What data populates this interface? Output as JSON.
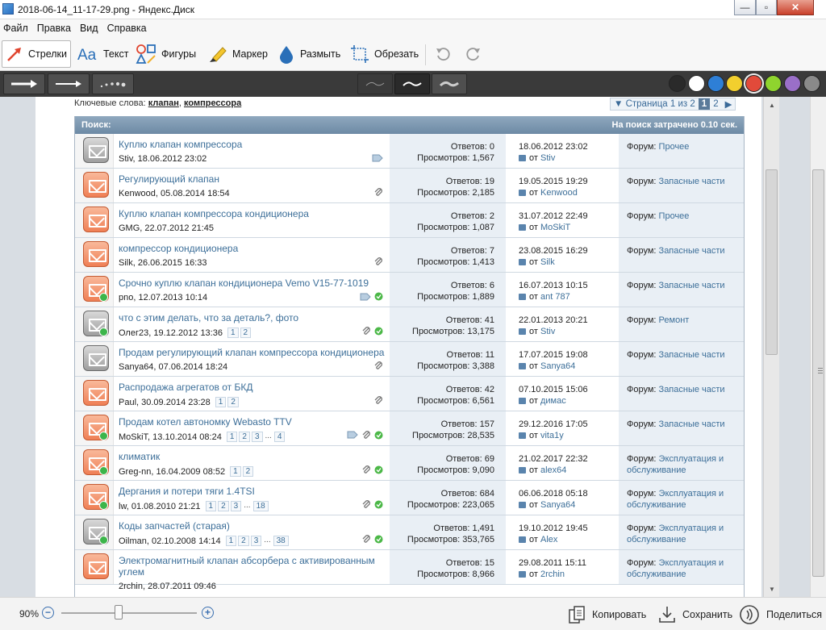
{
  "window": {
    "title": "2018-06-14_11-17-29.png - Яндекс.Диск",
    "minimize": "—",
    "maximize": "▫",
    "close": "✕"
  },
  "menu": [
    "Файл",
    "Правка",
    "Вид",
    "Справка"
  ],
  "toolbar": {
    "tools": [
      {
        "label": "Стрелки",
        "icon": "arrow-icon",
        "active": true
      },
      {
        "label": "Текст",
        "icon": "text-icon"
      },
      {
        "label": "Фигуры",
        "icon": "shapes-icon"
      },
      {
        "label": "Маркер",
        "icon": "marker-icon"
      },
      {
        "label": "Размыть",
        "icon": "blur-drop-icon"
      },
      {
        "label": "Обрезать",
        "icon": "crop-icon"
      }
    ]
  },
  "palette": {
    "colors": [
      "#2a2a2a",
      "#ffffff",
      "#2e7fd6",
      "#f2cf2e",
      "#e24a3a",
      "#8fd42e",
      "#9a6fc8",
      "#8a8a8a"
    ],
    "selected_index": 4
  },
  "content": {
    "keywords_label": "Ключевые слова:",
    "keyword_1": "клапан",
    "keyword_sep": ",",
    "keyword_2": "компрессора",
    "pager": {
      "label": "▼ Страница 1 из 2",
      "current": "1",
      "next_page": "2",
      "next": "▶"
    },
    "header_left": "Поиск:",
    "header_right": "На поиск затрачено 0.10 сек.",
    "rows": [
      {
        "title": "Куплю клапан компрессора",
        "meta": "Stiv, 18.06.2012 23:02",
        "replies": "Ответов: 0",
        "views": "Просмотров: 1,567",
        "last_date": "18.06.2012 23:02",
        "last_from": "от",
        "last_user": "Stiv",
        "forum_label": "Форум:",
        "forum": "Прочее",
        "forum2": "",
        "pages": []
      },
      {
        "title": "Регулирующий клапан",
        "meta": "Kenwood, 05.08.2014 18:54",
        "replies": "Ответов: 19",
        "views": "Просмотров: 2,185",
        "last_date": "19.05.2015 19:29",
        "last_from": "от",
        "last_user": "Kenwood",
        "forum_label": "Форум:",
        "forum": "Запасные части",
        "forum2": "",
        "pages": []
      },
      {
        "title": "Куплю клапан компрессора кондиционера",
        "meta": "GMG, 22.07.2012 21:45",
        "replies": "Ответов: 2",
        "views": "Просмотров: 1,087",
        "last_date": "31.07.2012 22:49",
        "last_from": "от",
        "last_user": "MoSkiT",
        "forum_label": "Форум:",
        "forum": "Прочее",
        "forum2": "",
        "pages": []
      },
      {
        "title": "компрессор кондиционера",
        "meta": "Silk, 26.06.2015 16:33",
        "replies": "Ответов: 7",
        "views": "Просмотров: 1,413",
        "last_date": "23.08.2015 16:29",
        "last_from": "от",
        "last_user": "Silk",
        "forum_label": "Форум:",
        "forum": "Запасные части",
        "forum2": "",
        "pages": []
      },
      {
        "title": "Срочно куплю клапан кондиционера Vemo V15-77-1019",
        "meta": "pno, 12.07.2013 10:14",
        "replies": "Ответов: 6",
        "views": "Просмотров: 1,889",
        "last_date": "16.07.2013 10:15",
        "last_from": "от",
        "last_user": "ant 787",
        "forum_label": "Форум:",
        "forum": "Запасные части",
        "forum2": "",
        "pages": []
      },
      {
        "title": "что с этим делать, что за деталь?, фото",
        "meta": "Олег23, 19.12.2012 13:36",
        "replies": "Ответов: 41",
        "views": "Просмотров: 13,175",
        "last_date": "22.01.2013 20:21",
        "last_from": "от",
        "last_user": "Stiv",
        "forum_label": "Форум:",
        "forum": "Ремонт",
        "forum2": "",
        "pages": [
          "1",
          "2"
        ]
      },
      {
        "title": "Продам регулирующий клапан компрессора кондиционера",
        "meta": "Sanya64, 07.06.2014 18:24",
        "replies": "Ответов: 11",
        "views": "Просмотров: 3,388",
        "last_date": "17.07.2015 19:08",
        "last_from": "от",
        "last_user": "Sanya64",
        "forum_label": "Форум:",
        "forum": "Запасные части",
        "forum2": "",
        "pages": []
      },
      {
        "title": "Распродажа агрегатов от БКД",
        "meta": "Paul, 30.09.2014 23:28",
        "replies": "Ответов: 42",
        "views": "Просмотров: 6,561",
        "last_date": "07.10.2015 15:06",
        "last_from": "от",
        "last_user": "димас",
        "forum_label": "Форум:",
        "forum": "Запасные части",
        "forum2": "",
        "pages": [
          "1",
          "2"
        ]
      },
      {
        "title": "Продам котел автономку Webasto TTV",
        "meta": "MoSkiT, 13.10.2014 08:24",
        "replies": "Ответов: 157",
        "views": "Просмотров: 28,535",
        "last_date": "29.12.2016 17:05",
        "last_from": "от",
        "last_user": "vita1y",
        "forum_label": "Форум:",
        "forum": "Запасные части",
        "forum2": "",
        "pages": [
          "1",
          "2",
          "3",
          "...",
          "4"
        ]
      },
      {
        "title": "климатик",
        "meta": "Greg-nn, 16.04.2009 08:52",
        "replies": "Ответов: 69",
        "views": "Просмотров: 9,090",
        "last_date": "21.02.2017 22:32",
        "last_from": "от",
        "last_user": "alex64",
        "forum_label": "Форум:",
        "forum": "Эксплуатация и",
        "forum2": "обслуживание",
        "pages": [
          "1",
          "2"
        ]
      },
      {
        "title": "Дергания и потери тяги 1.4TSI",
        "meta": "lw, 01.08.2010 21:21",
        "replies": "Ответов: 684",
        "views": "Просмотров: 223,065",
        "last_date": "06.06.2018 05:18",
        "last_from": "от",
        "last_user": "Sanya64",
        "forum_label": "Форум:",
        "forum": "Эксплуатация и",
        "forum2": "обслуживание",
        "pages": [
          "1",
          "2",
          "3",
          "...",
          "18"
        ]
      },
      {
        "title": "Коды запчастей (старая)",
        "meta": "Oilman, 02.10.2008 14:14",
        "replies": "Ответов: 1,491",
        "views": "Просмотров: 353,765",
        "last_date": "19.10.2012 19:45",
        "last_from": "от",
        "last_user": "Alex",
        "forum_label": "Форум:",
        "forum": "Эксплуатация и",
        "forum2": "обслуживание",
        "pages": [
          "1",
          "2",
          "3",
          "...",
          "38"
        ]
      },
      {
        "title": "Электромагнитный клапан абсорбера с активированным углем",
        "meta": "2rchin, 28.07.2011 09:46",
        "replies": "Ответов: 15",
        "views": "Просмотров: 8,966",
        "last_date": "29.08.2011 15:11",
        "last_from": "от",
        "last_user": "2rchin",
        "forum_label": "Форум:",
        "forum": "Эксплуатация и",
        "forum2": "обслуживание",
        "pages": []
      }
    ]
  },
  "statusbar": {
    "zoom": "90%",
    "zoom_level": 0.42,
    "copy": "Копировать",
    "save": "Сохранить",
    "share": "Поделиться"
  }
}
